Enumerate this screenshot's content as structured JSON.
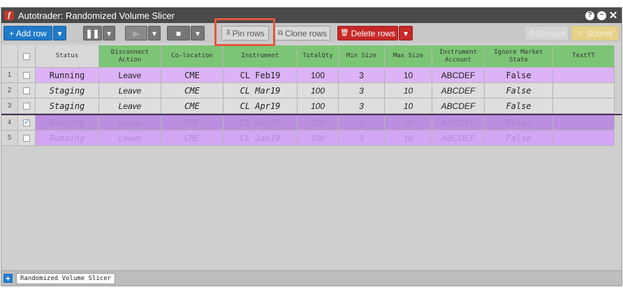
{
  "window": {
    "title": "Autotrader: Randomized Volume Slicer",
    "app_icon": "autotrader-logo-icon",
    "controls": [
      "help-icon",
      "minimize-icon",
      "close-icon"
    ]
  },
  "toolbar": {
    "add_row": "+ Add row",
    "pause_icon": "pause-icon",
    "play_icon": "play-icon",
    "stop_icon": "stop-icon",
    "pin_rows": "Pin rows",
    "clone_rows": "Clone rows",
    "delete_rows": "Delete rows",
    "discard": "Discard",
    "submit": "Submit"
  },
  "columns": [
    "Status",
    "Disconnect Action",
    "Co-location",
    "Instrument",
    "TotalQty",
    "Min Size",
    "Max Size",
    "Instrument Account",
    "Ignore Market State",
    "TextTT"
  ],
  "rows": [
    {
      "num": "1",
      "checked": false,
      "style": "purple",
      "status": "Running",
      "disconnect": "Leave",
      "coloc": "CME",
      "instrument": "CL Feb19",
      "totalqty": "100",
      "min": "3",
      "max": "10",
      "account": "ABCDEF",
      "ignore": "False",
      "text": ""
    },
    {
      "num": "2",
      "checked": false,
      "style": "grey",
      "status": "Staging",
      "disconnect": "Leave",
      "coloc": "CME",
      "instrument": "CL Mar19",
      "totalqty": "100",
      "min": "3",
      "max": "10",
      "account": "ABCDEF",
      "ignore": "False",
      "text": ""
    },
    {
      "num": "3",
      "checked": false,
      "style": "grey",
      "status": "Staging",
      "disconnect": "Leave",
      "coloc": "CME",
      "instrument": "CL Apr19",
      "totalqty": "100",
      "min": "3",
      "max": "10",
      "account": "ABCDEF",
      "ignore": "False",
      "text": ""
    },
    {
      "num": "4",
      "checked": true,
      "style": "sel",
      "status": "Running",
      "disconnect": "Leave",
      "coloc": "CME",
      "instrument": "CL Dec18",
      "totalqty": "100",
      "min": "3",
      "max": "10",
      "account": "ABCDEF",
      "ignore": "False",
      "text": ""
    },
    {
      "num": "5",
      "checked": false,
      "style": "sel2",
      "status": "Running",
      "disconnect": "Leave",
      "coloc": "CME",
      "instrument": "CL Jan19",
      "totalqty": "100",
      "min": "3",
      "max": "10",
      "account": "ABCDEF",
      "ignore": "False",
      "text": ""
    }
  ],
  "sheet_tab": "Randomized Volume Slicer",
  "colors": {
    "accent": "#1f7ac9",
    "delete": "#c62828",
    "running_row": "#dcb3f7",
    "header_green": "#7cc576",
    "highlight": "#e2583e"
  }
}
